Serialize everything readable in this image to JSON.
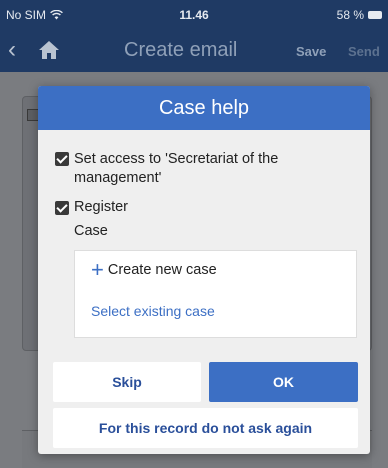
{
  "status_bar": {
    "carrier": "No SIM",
    "time": "11.46",
    "battery": "58 %"
  },
  "nav": {
    "title": "Create email",
    "save_label": "Save",
    "send_label": "Send"
  },
  "dialog": {
    "title": "Case help",
    "checkbox_access_label": "Set access to 'Secretariat of the management'",
    "checkbox_access_checked": true,
    "checkbox_register_label": "Register",
    "checkbox_register_checked": true,
    "case_label": "Case",
    "create_new_case_label": "Create new case",
    "select_existing_case_label": "Select existing case",
    "skip_label": "Skip",
    "ok_label": "OK",
    "do_not_ask_label": "For this record do not ask again"
  },
  "colors": {
    "accent": "#3c6fc4",
    "navbar": "#1f3a64",
    "link": "#2a4f9a"
  }
}
